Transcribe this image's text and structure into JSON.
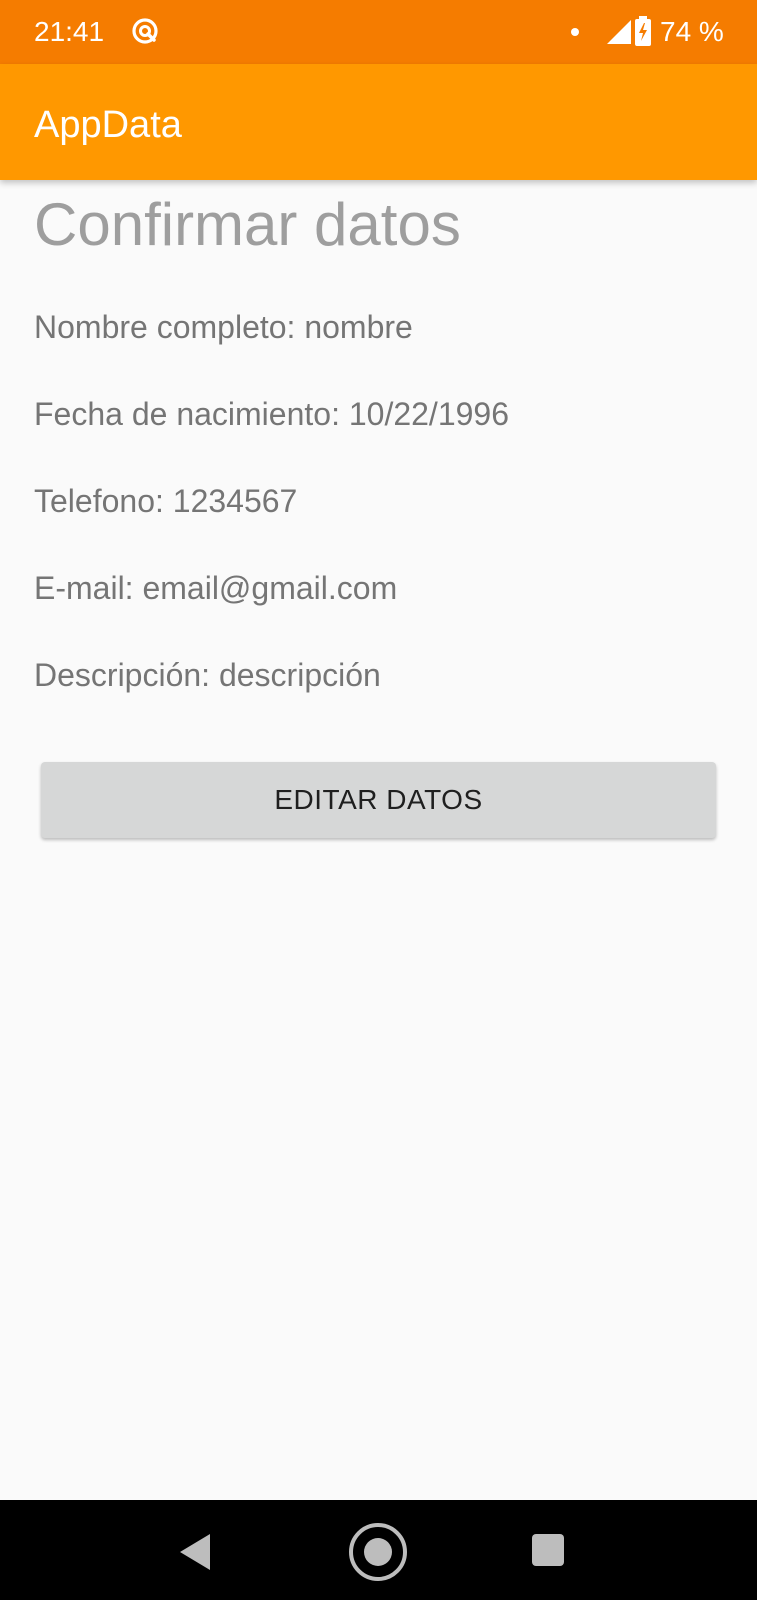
{
  "status_bar": {
    "time": "21:41",
    "battery": "74 %",
    "left_icon": "sync-icon",
    "signal_icon": "signal-icon",
    "battery_icon": "battery-charging-icon"
  },
  "app_bar": {
    "title": "AppData",
    "color": "#ff9800"
  },
  "page": {
    "title": "Confirmar datos"
  },
  "fields": [
    {
      "label": "Nombre completo:",
      "value": "nombre"
    },
    {
      "label": "Fecha de nacimiento:",
      "value": "10/22/1996"
    },
    {
      "label": "Telefono:",
      "value": "1234567"
    },
    {
      "label": "E-mail:",
      "value": "email@gmail.com"
    },
    {
      "label": "Descripción:",
      "value": "descripción"
    }
  ],
  "actions": {
    "edit_label": "EDITAR DATOS"
  },
  "nav_bar": {
    "back_icon": "back-icon",
    "home_icon": "home-icon",
    "recents_icon": "recents-icon"
  },
  "colors": {
    "status_bar": "#f57c00",
    "accent": "#ff9800",
    "background": "#fafafa",
    "button": "#d6d7d7"
  }
}
